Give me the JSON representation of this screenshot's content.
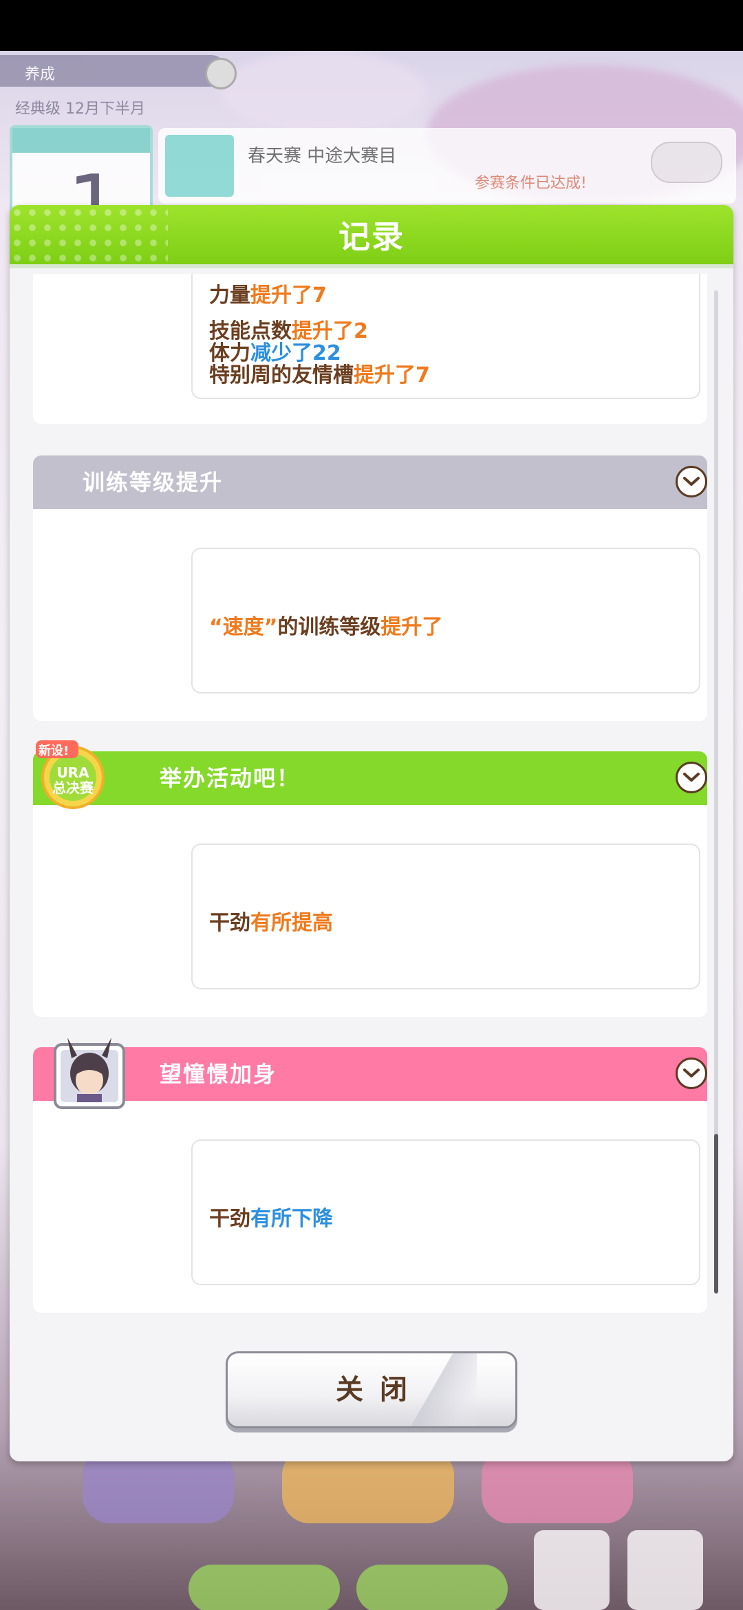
{
  "background": {
    "top_label": "养成",
    "sub_label": "经典级 12月下半月",
    "goal_text": "春天赛 中途大赛目",
    "goal_note": "参赛条件已达成!",
    "turn_number": "1"
  },
  "dialog": {
    "title": "记录",
    "close_label": "关闭"
  },
  "records": [
    {
      "lines": [
        [
          {
            "t": "力量",
            "c": "n"
          },
          {
            "t": "提升了7",
            "c": "up"
          }
        ],
        [
          {
            "t": "技能点数",
            "c": "n"
          },
          {
            "t": "提升了2",
            "c": "up"
          }
        ],
        [
          {
            "t": "体力",
            "c": "n"
          },
          {
            "t": "减少了22",
            "c": "down"
          }
        ],
        [
          {
            "t": "特别周的友情槽",
            "c": "n"
          },
          {
            "t": "提升了7",
            "c": "up"
          }
        ]
      ]
    },
    {
      "title": "训练等级提升",
      "header_color": "#c2c0cc",
      "lines": [
        [
          {
            "t": "“速度”",
            "c": "up"
          },
          {
            "t": "的训练等级",
            "c": "n"
          },
          {
            "t": "提升了",
            "c": "up"
          }
        ]
      ]
    },
    {
      "title": "举办活动吧！",
      "header_color": "#84d92a",
      "badge": "URA总决赛",
      "badge_new": "新设!",
      "lines": [
        [
          {
            "t": "干劲",
            "c": "n"
          },
          {
            "t": "有所提高",
            "c": "up"
          }
        ]
      ]
    },
    {
      "title": "望憧憬加身",
      "header_color": "#ff7aa5",
      "lines": [
        [
          {
            "t": "干劲",
            "c": "n"
          },
          {
            "t": "有所下降",
            "c": "down"
          }
        ]
      ]
    }
  ]
}
